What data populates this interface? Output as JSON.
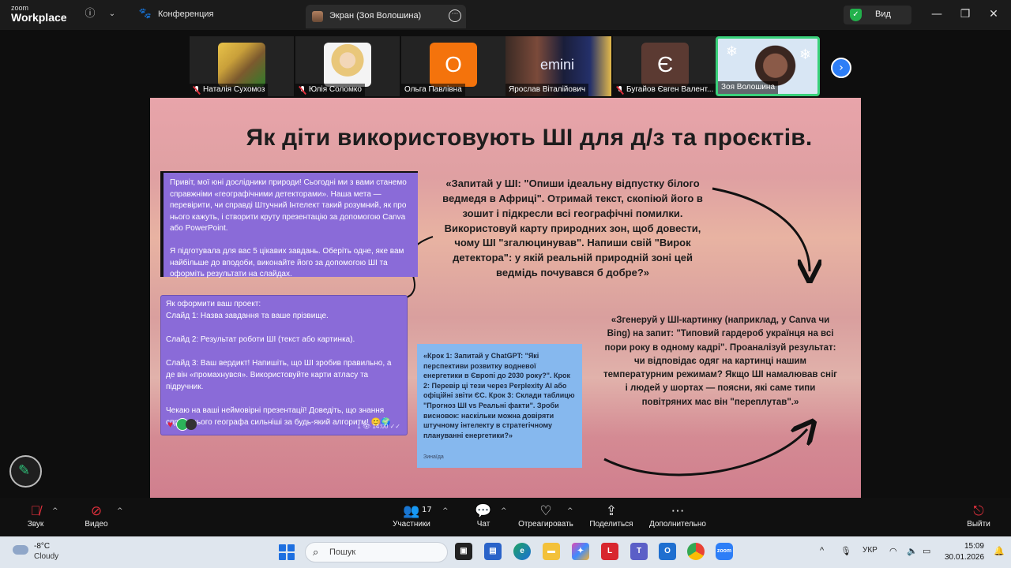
{
  "titlebar": {
    "logo_small": "zoom",
    "logo_big": "Workplace",
    "info_icon": "info-icon",
    "meeting_label": "Конференция",
    "active_tab_label": "Экран (Зоя Волошина)",
    "view_label": "Вид",
    "more_glyph": "···"
  },
  "participants": [
    {
      "name": "Наталія Сухомоз",
      "muted": true,
      "kind": "photo-cat"
    },
    {
      "name": "Юлія Соломко",
      "muted": true,
      "kind": "photo-woman"
    },
    {
      "name": "Ольга Павлівна",
      "muted": false,
      "kind": "letter",
      "letter": "О",
      "color": "#f4730c"
    },
    {
      "name": "Ярослав Віталійович",
      "muted": false,
      "kind": "gemini",
      "overlay": "emini"
    },
    {
      "name": "Бугайов Євген Валент...",
      "muted": true,
      "kind": "letter",
      "letter": "Є",
      "color": "#5b3a32"
    },
    {
      "name": "Зоя Волошина",
      "muted": false,
      "kind": "video",
      "speaking": true
    }
  ],
  "slide": {
    "title": "Як діти використовують ШІ для д/з та проєктів.",
    "chat1": "Привіт, мої юні дослідники природи! Сьогодні ми з вами станемо справжніми «географічними детекторами». Наша мета — перевірити, чи справді Штучний Інтелект такий розумний, як про нього кажуть, і створити круту презентацію за допомогою Canva або PowerPoint.\n\nЯ підготувала для вас 5 цікавих завдань. Оберіть одне, яке вам найбільше до вподоби, виконайте його за допомогою ШІ та оформіть результати на слайдах.",
    "chat2": "Як оформити ваш проект:\nСлайд 1: Назва завдання та ваше прізвище.\n\nСлайд 2: Результат роботи ШІ (текст або картинка).\n\nСлайд 3: Ваш вердикт! Напишіть, що ШІ зробив правильно, а де він «промахнувся». Використовуйте карти атласу та підручник.\n\nЧекаю на ваші неймовірні презентації! Доведіть, що знання справжнього географа сильніші за будь-який алгоритм! 😊🌍",
    "chat2_time": "1 👁 14:00 ✓✓",
    "chat2_avatar": "ЮШ",
    "quote1": "«Запитай у ШІ: \"Опиши ідеальну відпустку білого ведмедя в Африці\". Отримай текст, скопіюй його в зошит і підкресли всі географічні помилки. Використовуй карту природних зон, щоб довести, чому ШІ \"згалюцинував\". Напиши свій \"Вирок детектора\": у якій реальній природній зоні цей ведмідь почувався б добре?»",
    "note": "«Крок 1: Запитай у ChatGPT: \"Які перспективи розвитку водневої енергетики в Європі до 2030 року?\". Крок 2: Перевір ці тези через Perplexity AI або офіційні звіти ЄС. Крок 3: Склади таблицю \"Прогноз ШІ vs Реальні факти\". Зроби висновок: наскільки можна довіряти штучному інтелекту в стратегічному плануванні енергетики?»",
    "note_author": "Зинаїда",
    "quote2": "«Згенеруй у ШІ-картинку (наприклад, у Canva чи Bing) на запит: \"Типовий гардероб українця на всі пори року в одному кадрі\". Проаналізуй результат: чи відповідає одяг на картинці нашим температурним режимам? Якщо ШІ намалював сніг і людей у шортах — поясни, які саме типи повітряних мас він \"переплутав\".»"
  },
  "controls": {
    "audio": "Звук",
    "video": "Видео",
    "participants": "Участники",
    "participants_count": "17",
    "chat": "Чат",
    "react": "Отреагировать",
    "share": "Поделиться",
    "more": "Дополнительно",
    "leave": "Выйти"
  },
  "taskbar": {
    "temp": "-8°C",
    "condition": "Cloudy",
    "search_placeholder": "Пошук",
    "lang": "УКР",
    "time": "15:09",
    "date": "30.01.2026"
  },
  "colors": {
    "zoom_blue": "#2d7ef7",
    "speaking_green": "#3ad17b",
    "chat_purple": "#8a6bd8",
    "note_blue": "#86b8ee"
  }
}
